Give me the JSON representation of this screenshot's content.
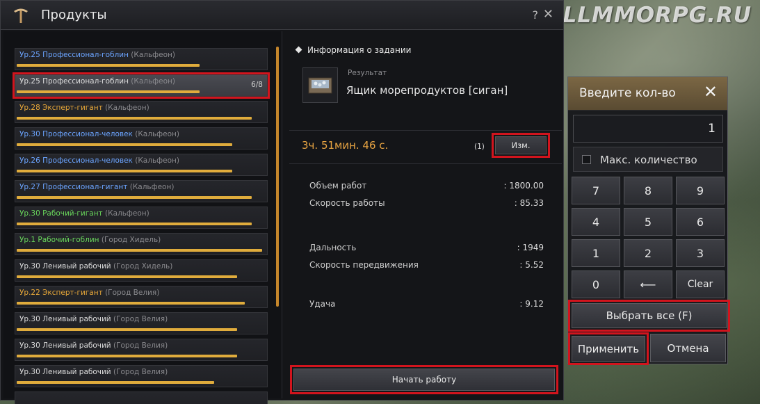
{
  "watermark": "ALLMMORPG.RU",
  "window": {
    "title": "Продукты",
    "help": "?",
    "close": "✕"
  },
  "workers": [
    {
      "level_name": "Ур.25 Профессионал-гоблин",
      "location": "(Кальфеон)",
      "color": "blue",
      "progress": 0.73,
      "count": "",
      "selected": false
    },
    {
      "level_name": "Ур.25 Профессионал-гоблин",
      "location": "(Кальфеон)",
      "color": "white",
      "progress": 0.73,
      "count": "6/8",
      "selected": true
    },
    {
      "level_name": "Ур.28 Эксперт-гигант",
      "location": "(Кальфеон)",
      "color": "orange",
      "progress": 0.94,
      "count": "",
      "selected": false
    },
    {
      "level_name": "Ур.30 Профессионал-человек",
      "location": "(Кальфеон)",
      "color": "blue",
      "progress": 0.86,
      "count": "",
      "selected": false
    },
    {
      "level_name": "Ур.26 Профессионал-человек",
      "location": "(Кальфеон)",
      "color": "blue",
      "progress": 0.86,
      "count": "",
      "selected": false
    },
    {
      "level_name": "Ур.27 Профессионал-гигант",
      "location": "(Кальфеон)",
      "color": "blue",
      "progress": 0.94,
      "count": "",
      "selected": false
    },
    {
      "level_name": "Ур.30 Рабочий-гигант",
      "location": "(Кальфеон)",
      "color": "green",
      "progress": 0.94,
      "count": "",
      "selected": false
    },
    {
      "level_name": "Ур.1 Рабочий-гоблин",
      "location": "(Город Хидель)",
      "color": "green",
      "progress": 0.98,
      "count": "",
      "selected": false
    },
    {
      "level_name": "Ур.30 Ленивый рабочий",
      "location": "(Город Хидель)",
      "color": "white",
      "progress": 0.88,
      "count": "",
      "selected": false
    },
    {
      "level_name": "Ур.22 Эксперт-гигант",
      "location": "(Город Велия)",
      "color": "orange",
      "progress": 0.91,
      "count": "",
      "selected": false
    },
    {
      "level_name": "Ур.30 Ленивый рабочий",
      "location": "(Город Велия)",
      "color": "white",
      "progress": 0.88,
      "count": "",
      "selected": false
    },
    {
      "level_name": "Ур.30 Ленивый рабочий",
      "location": "(Город Велия)",
      "color": "white",
      "progress": 0.88,
      "count": "",
      "selected": false
    },
    {
      "level_name": "Ур.30 Ленивый рабочий",
      "location": "(Город Велия)",
      "color": "white",
      "progress": 0.79,
      "count": "",
      "selected": false
    },
    {
      "level_name": "",
      "location": "",
      "color": "white",
      "progress": 0.9,
      "count": "",
      "selected": false
    }
  ],
  "task": {
    "header": "Информация о задании",
    "result_label": "Результат",
    "result_name": "Ящик морепродуктов [сиган]",
    "timer": "3ч. 51мин. 46 с.",
    "quantity": "(1)",
    "change_label": "Изм.",
    "stats": [
      {
        "label": "Объем работ",
        "value": ": 1800.00"
      },
      {
        "label": "Скорость работы",
        "value": ": 85.33"
      },
      {
        "label": "Дальность",
        "value": ": 1949"
      },
      {
        "label": "Скорость передвижения",
        "value": ": 5.52"
      },
      {
        "label": "Удача",
        "value": ": 9.12"
      }
    ],
    "start_label": "Начать работу"
  },
  "qty_dialog": {
    "title": "Введите кол-во",
    "close": "✕",
    "value": "1",
    "max_label": "Макс. количество",
    "keys": [
      "7",
      "8",
      "9",
      "4",
      "5",
      "6",
      "1",
      "2",
      "3",
      "0",
      "⟵",
      "Clear"
    ],
    "select_all_label": "Выбрать все (F)",
    "apply_label": "Применить",
    "cancel_label": "Отмена"
  }
}
